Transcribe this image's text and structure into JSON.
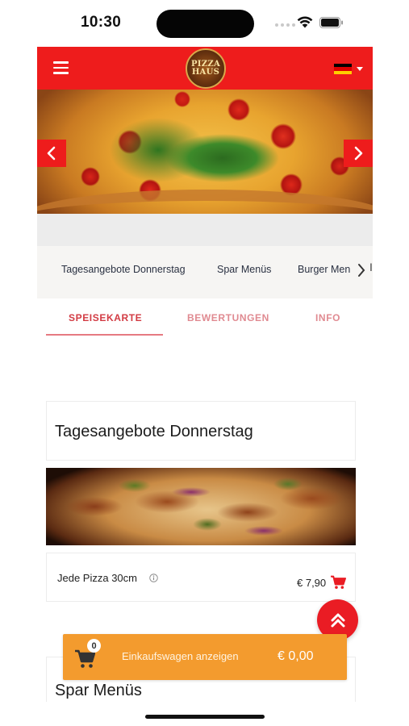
{
  "status_bar": {
    "time": "10:30"
  },
  "header": {
    "logo_line1": "PIZZA",
    "logo_line2": "HAUS",
    "language_flag": "german-flag",
    "flag_colors": [
      "#000000",
      "#dd0000",
      "#ffce00"
    ]
  },
  "colors": {
    "brand_red": "#ee1c1c",
    "tab_active": "#d23b43",
    "cart_orange": "#f39b2e"
  },
  "categories": [
    {
      "label": "Tagesangebote Donnerstag"
    },
    {
      "label": "Spar Menüs"
    },
    {
      "label": "Burger Men"
    }
  ],
  "categories_cut_text": "I",
  "tabs": [
    {
      "label": "SPEISEKARTE",
      "active": true
    },
    {
      "label": "BEWERTUNGEN",
      "active": false
    },
    {
      "label": "INFO",
      "active": false
    }
  ],
  "sections": [
    {
      "title": "Tagesangebote Donnerstag",
      "items": [
        {
          "name": "Jede Pizza 30cm",
          "price": "€ 7,90"
        }
      ]
    },
    {
      "title": "Spar Menüs"
    }
  ],
  "cart": {
    "count": "0",
    "label": "Einkaufswagen anzeigen",
    "total": "€ 0,00"
  }
}
